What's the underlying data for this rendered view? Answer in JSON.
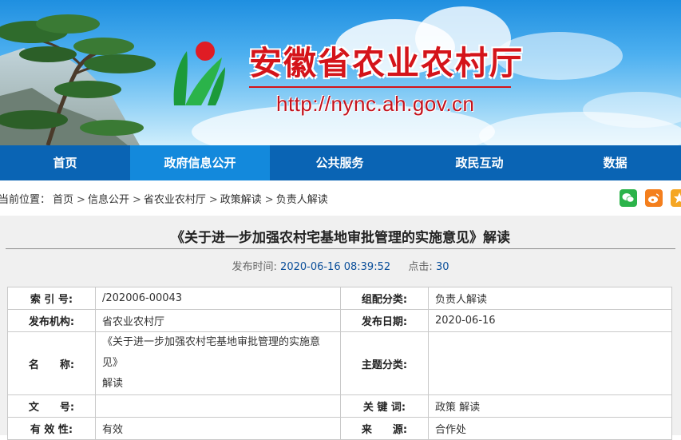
{
  "site": {
    "title": "安徽省农业农村厅",
    "url": "http://nync.ah.gov.cn"
  },
  "nav": {
    "items": [
      {
        "label": "首页"
      },
      {
        "label": "政府信息公开",
        "active": true
      },
      {
        "label": "公共服务"
      },
      {
        "label": "政民互动"
      },
      {
        "label": "数据"
      }
    ]
  },
  "breadcrumb": {
    "prefix": "当前位置：",
    "items": [
      "首页",
      "信息公开",
      "省农业农村厅",
      "政策解读",
      "负责人解读"
    ],
    "separator": ">"
  },
  "share": {
    "icons": [
      "wechat-icon",
      "weibo-icon",
      "star-icon"
    ],
    "colors": {
      "wechat": "#2bb34a",
      "weibo": "#f47f1d",
      "star": "#f5a623"
    }
  },
  "article": {
    "title": "《关于进一步加强农村宅基地审批管理的实施意见》解读",
    "publish_label": "发布时间:",
    "publish_value": "2020-06-16 08:39:52",
    "clicks_label": "点击:",
    "clicks_value": "30"
  },
  "metaTable": {
    "index_label": "索 引 号:",
    "index_value": "/202006-00043",
    "group_label": "组配分类:",
    "group_value": "负责人解读",
    "org_label": "发布机构:",
    "org_value": "省农业农村厅",
    "date_label": "发布日期:",
    "date_value": "2020-06-16",
    "name_label": "名　　称:",
    "name_value_line1": "《关于进一步加强农村宅基地审批管理的实施意见》",
    "name_value_line2": "解读",
    "topic_label": "主题分类:",
    "topic_value": "",
    "docno_label": "文　　号:",
    "docno_value": "",
    "keywords_label": "关 键 词:",
    "keywords_value": "政策 解读",
    "validity_label": "有 效 性:",
    "validity_value": "有效",
    "source_label": "来　　源:",
    "source_value": "合作处"
  },
  "colors": {
    "nav": "#0a64b4",
    "nav_active": "#1389dc",
    "brand_red": "#d4141a",
    "meta_value": "#0b4f9a"
  }
}
